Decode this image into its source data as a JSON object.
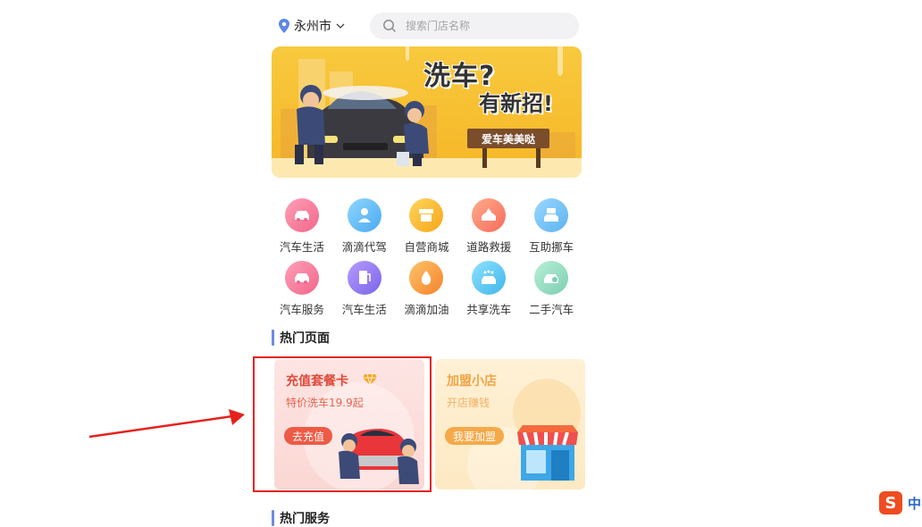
{
  "topbar": {
    "city": "永州市",
    "search_placeholder": "搜索门店名称"
  },
  "banner": {
    "headline1": "洗车?",
    "headline2": "有新招!",
    "sign": "爱车美美哒"
  },
  "grid": {
    "row1": [
      "汽车生活",
      "滴滴代驾",
      "自营商城",
      "道路救援",
      "互助挪车"
    ],
    "row2": [
      "汽车服务",
      "汽车生活",
      "滴滴加油",
      "共享洗车",
      "二手汽车"
    ]
  },
  "sections": {
    "hot_pages": "热门页面",
    "hot_services": "热门服务"
  },
  "cards": {
    "recharge": {
      "title": "充值套餐卡",
      "subtitle": "特价洗车19.9起",
      "button": "去充值"
    },
    "franchise": {
      "title": "加盟小店",
      "subtitle": "开店赚钱",
      "button": "我要加盟"
    }
  },
  "ime": {
    "logo": "S",
    "lang": "中"
  },
  "colors": {
    "accent_blue": "#6e8ae0",
    "banner_yellow": "#f8c93e",
    "recharge_red": "#ee5a45",
    "franchise_orange": "#f6a948",
    "annotation_red": "#e6211d"
  }
}
